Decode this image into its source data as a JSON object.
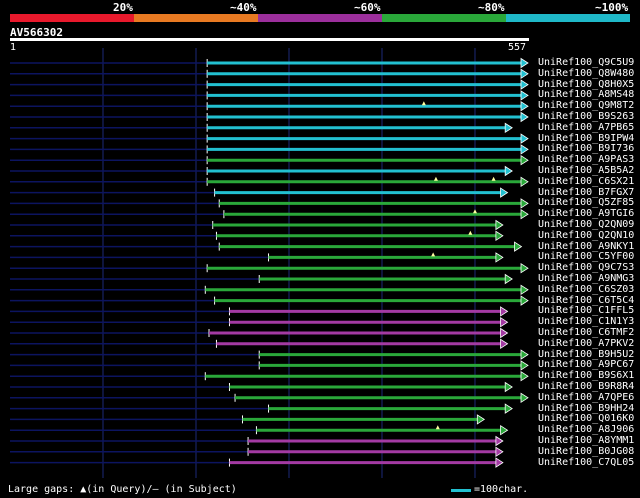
{
  "legend": {
    "labels": [
      "20%",
      "~40%",
      "~60%",
      "~80%",
      "~100%"
    ],
    "colors": [
      "#e8192c",
      "#e87a22",
      "#9c2f9c",
      "#2aa83a",
      "#1fb8c8"
    ]
  },
  "query": {
    "name": "AV566302",
    "start": "1",
    "end": "557",
    "length": 557
  },
  "colors": {
    "cyan": "#22c0d0",
    "green": "#2aa83a",
    "magenta": "#a33aa3",
    "dark": "#0c1460",
    "gap": "#ffffa0"
  },
  "hits": [
    {
      "id": "UniRef100_Q9C5U9",
      "color": "cyan",
      "start": 212,
      "end": 557
    },
    {
      "id": "UniRef100_Q8W480",
      "color": "cyan",
      "start": 212,
      "end": 557
    },
    {
      "id": "UniRef100_Q8H0X5",
      "color": "cyan",
      "start": 212,
      "end": 557
    },
    {
      "id": "UniRef100_A8MS48",
      "color": "cyan",
      "start": 212,
      "end": 557
    },
    {
      "id": "UniRef100_Q9M8T2",
      "color": "cyan",
      "start": 212,
      "end": 557,
      "gaps": [
        445
      ]
    },
    {
      "id": "UniRef100_B9S263",
      "color": "cyan",
      "start": 212,
      "end": 557
    },
    {
      "id": "UniRef100_A7PB65",
      "color": "cyan",
      "start": 212,
      "end": 540
    },
    {
      "id": "UniRef100_B9IPW4",
      "color": "cyan",
      "start": 212,
      "end": 557
    },
    {
      "id": "UniRef100_B9I736",
      "color": "cyan",
      "start": 212,
      "end": 557
    },
    {
      "id": "UniRef100_A9PAS3",
      "color": "green",
      "start": 212,
      "end": 557
    },
    {
      "id": "UniRef100_A5B5A2",
      "color": "cyan",
      "start": 212,
      "end": 540
    },
    {
      "id": "UniRef100_C6SX21",
      "color": "green",
      "start": 212,
      "end": 557,
      "gaps": [
        458,
        520
      ]
    },
    {
      "id": "UniRef100_B7FGX7",
      "color": "cyan",
      "start": 220,
      "end": 535
    },
    {
      "id": "UniRef100_Q5ZF85",
      "color": "green",
      "start": 225,
      "end": 557
    },
    {
      "id": "UniRef100_A9TGI6",
      "color": "green",
      "start": 230,
      "end": 557,
      "gaps": [
        500
      ]
    },
    {
      "id": "UniRef100_Q2QN09",
      "color": "green",
      "start": 218,
      "end": 530
    },
    {
      "id": "UniRef100_Q2QN10",
      "color": "green",
      "start": 222,
      "end": 530,
      "gaps": [
        495
      ]
    },
    {
      "id": "UniRef100_A9NKY1",
      "color": "green",
      "start": 225,
      "end": 550
    },
    {
      "id": "UniRef100_C5YF00",
      "color": "green",
      "start": 278,
      "end": 530,
      "gaps": [
        455
      ]
    },
    {
      "id": "UniRef100_Q9C7S3",
      "color": "green",
      "start": 212,
      "end": 557
    },
    {
      "id": "UniRef100_A9NMG3",
      "color": "green",
      "start": 268,
      "end": 540
    },
    {
      "id": "UniRef100_C6SZ03",
      "color": "green",
      "start": 210,
      "end": 557
    },
    {
      "id": "UniRef100_C6T5C4",
      "color": "green",
      "start": 220,
      "end": 557
    },
    {
      "id": "UniRef100_C1FFL5",
      "color": "magenta",
      "start": 236,
      "end": 535
    },
    {
      "id": "UniRef100_C1N1Y3",
      "color": "magenta",
      "start": 236,
      "end": 535
    },
    {
      "id": "UniRef100_C6TMF2",
      "color": "magenta",
      "start": 214,
      "end": 535
    },
    {
      "id": "UniRef100_A7PKV2",
      "color": "magenta",
      "start": 222,
      "end": 535
    },
    {
      "id": "UniRef100_B9H5U2",
      "color": "green",
      "start": 268,
      "end": 557
    },
    {
      "id": "UniRef100_A9PC67",
      "color": "green",
      "start": 268,
      "end": 557
    },
    {
      "id": "UniRef100_B9S6X1",
      "color": "green",
      "start": 210,
      "end": 557
    },
    {
      "id": "UniRef100_B9R8R4",
      "color": "green",
      "start": 236,
      "end": 540
    },
    {
      "id": "UniRef100_A7QPE6",
      "color": "green",
      "start": 242,
      "end": 557
    },
    {
      "id": "UniRef100_B9HH24",
      "color": "green",
      "start": 278,
      "end": 540
    },
    {
      "id": "UniRef100_Q016K0",
      "color": "green",
      "start": 250,
      "end": 510
    },
    {
      "id": "UniRef100_A8J906",
      "color": "green",
      "start": 265,
      "end": 535,
      "gaps": [
        460
      ]
    },
    {
      "id": "UniRef100_A8YMM1",
      "color": "magenta",
      "start": 256,
      "end": 530
    },
    {
      "id": "UniRef100_B0JG08",
      "color": "magenta",
      "start": 256,
      "end": 530
    },
    {
      "id": "UniRef100_C7QL05",
      "color": "magenta",
      "start": 236,
      "end": 530
    }
  ],
  "footer": {
    "gaps_text": "Large gaps: ▲(in Query)/– (in Subject)",
    "scale_text": "=100char."
  }
}
